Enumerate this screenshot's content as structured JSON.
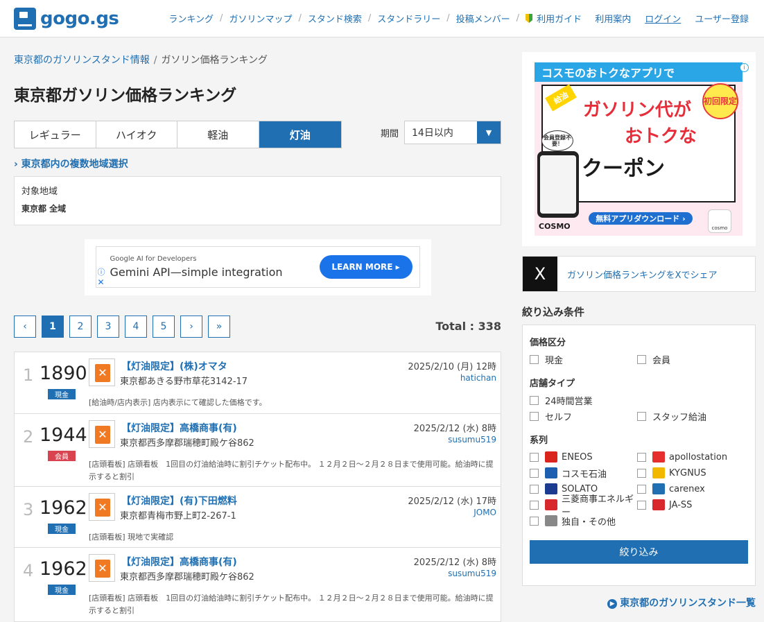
{
  "header": {
    "logo_text": "gogo.gs",
    "nav": [
      "ランキング",
      "ガソリンマップ",
      "スタンド検索",
      "スタンドラリー",
      "投稿メンバー",
      "利用ガイド"
    ],
    "links": {
      "info": "利用案内",
      "login": "ログイン",
      "register": "ユーザー登録"
    }
  },
  "breadcrumb": {
    "home": "東京都のガソリンスタンド情報",
    "sep": "/",
    "current": "ガソリン価格ランキング"
  },
  "page_title": "東京都ガソリン価格ランキング",
  "tabs": [
    "レギュラー",
    "ハイオク",
    "軽油",
    "灯油"
  ],
  "period": {
    "label": "期間",
    "value": "14日以内",
    "chevron": "chevron-down-icon"
  },
  "region": {
    "toggle": "東京都内の複数地域選択",
    "label": "対象地域",
    "value": "東京都 全域"
  },
  "google_ad": {
    "small": "Google AI for Developers",
    "headline": "Gemini API—simple integration",
    "cta": "LEARN MORE ▸",
    "info": "ⓘ",
    "close": "✕"
  },
  "pager": {
    "pages": [
      "‹",
      "1",
      "2",
      "3",
      "4",
      "5",
      "›",
      "»"
    ],
    "active": "1",
    "total": "Total : 338"
  },
  "listings": [
    {
      "rank": "1",
      "price": "1890",
      "badge": "現金",
      "badge_type": "cash",
      "name": "【灯油限定】(株)オマタ",
      "address": "東京都あきる野市草花3142-17",
      "date": "2025/2/10 (月) 12時",
      "user": "hatichan",
      "note": "[給油時/店内表示] 店内表示にて確認した価格です。"
    },
    {
      "rank": "2",
      "price": "1944",
      "badge": "会員",
      "badge_type": "member",
      "name": "【灯油限定】高橋商事(有)",
      "address": "東京都西多摩郡瑞穂町殿ケ谷862",
      "date": "2025/2/12 (水) 8時",
      "user": "susumu519",
      "note": "[店頭看板] 店頭看板　1回目の灯油給油時に割引チケット配布中。 １２月２日～２月２８日まで使用可能。給油時に提示すると割引"
    },
    {
      "rank": "3",
      "price": "1962",
      "badge": "現金",
      "badge_type": "cash",
      "name": "【灯油限定】(有)下田燃料",
      "address": "東京都青梅市野上町2-267-1",
      "date": "2025/2/12 (水) 17時",
      "user": "JOMO",
      "note": "[店頭看板] 現地で実確認"
    },
    {
      "rank": "4",
      "price": "1962",
      "badge": "現金",
      "badge_type": "cash",
      "name": "【灯油限定】高橋商事(有)",
      "address": "東京都西多摩郡瑞穂町殿ケ谷862",
      "date": "2025/2/12 (水) 8時",
      "user": "susumu519",
      "note": "[店頭看板] 店頭看板　1回目の灯油給油時に割引チケット配布中。 １２月２日～２月２８日まで使用可能。給油時に提示すると割引"
    }
  ],
  "cosmo_ad": {
    "top": "コスモのおトクなアプリで",
    "ribbon": "給油",
    "badge": "初回限定",
    "line1": "ガソリン代が",
    "line2": "おトクな",
    "line3": "クーポン",
    "register": "会員登録不要！",
    "download": "無料アプリダウンロード ›",
    "logo": "COSMO",
    "logo2": "cosmo",
    "info": "i"
  },
  "share": {
    "icon": "X",
    "text": "ガソリン価格ランキングをXでシェア"
  },
  "filter": {
    "title": "絞り込み条件",
    "sections": {
      "price": {
        "title": "価格区分",
        "options": [
          "現金",
          "会員"
        ]
      },
      "store": {
        "title": "店舗タイプ",
        "options": [
          "24時間営業",
          "",
          "セルフ",
          "スタッフ給油"
        ]
      },
      "brand": {
        "title": "系列",
        "options": [
          "ENEOS",
          "apollostation",
          "コスモ石油",
          "KYGNUS",
          "SOLATO",
          "carenex",
          "三菱商事エネルギー",
          "JA-SS",
          "独自・その他"
        ]
      }
    },
    "submit": "絞り込み",
    "brand_colors": [
      "#d9251d",
      "#e62e2e",
      "#1f5fb0",
      "#f2b800",
      "#1a3b8f",
      "#1f6fb2",
      "#d8282e",
      "#d8282e",
      "#888888"
    ]
  },
  "side_link": "東京都のガソリンスタンド一覧"
}
